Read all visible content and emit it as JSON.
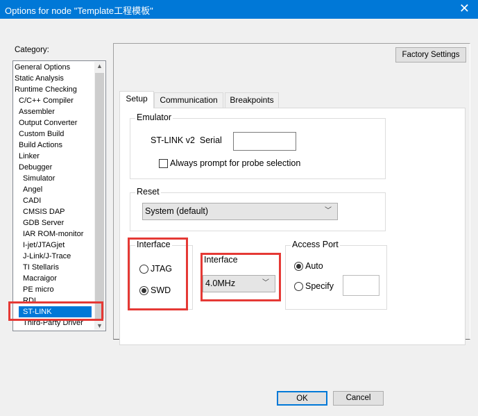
{
  "window": {
    "title": "Options for node \"Template工程模板\"",
    "close": "✕"
  },
  "category": {
    "label": "Category:",
    "items": [
      "General Options",
      "Static Analysis",
      "Runtime Checking",
      "C/C++ Compiler",
      "Assembler",
      "Output Converter",
      "Custom Build",
      "Build Actions",
      "Linker",
      "Debugger",
      "Simulator",
      "Angel",
      "CADI",
      "CMSIS DAP",
      "GDB Server",
      "IAR ROM-monitor",
      "I-jet/JTAGjet",
      "J-Link/J-Trace",
      "TI Stellaris",
      "Macraigor",
      "PE micro",
      "RDI",
      "ST-LINK",
      "Third-Party Driver"
    ],
    "selected": "ST-LINK"
  },
  "factory_settings": "Factory Settings",
  "tabs": [
    "Setup",
    "Communication",
    "Breakpoints"
  ],
  "emulator": {
    "legend": "Emulator",
    "probe_label": "ST-LINK v2  Serial",
    "serial_value": "",
    "always_prompt": "Always prompt for probe selection",
    "always_prompt_checked": false
  },
  "reset": {
    "legend": "Reset",
    "value": "System (default)"
  },
  "interface": {
    "legend": "Interface",
    "options": [
      "JTAG",
      "SWD"
    ],
    "selected": "SWD"
  },
  "interface_speed": {
    "label": "Interface",
    "value": "4.0MHz"
  },
  "access_port": {
    "legend": "Access Port",
    "options": [
      "Auto",
      "Specify"
    ],
    "selected": "Auto",
    "specify_value": ""
  },
  "buttons": {
    "ok": "OK",
    "cancel": "Cancel"
  },
  "colors": {
    "titlebar": "#0078d7",
    "highlight": "#e53935"
  }
}
